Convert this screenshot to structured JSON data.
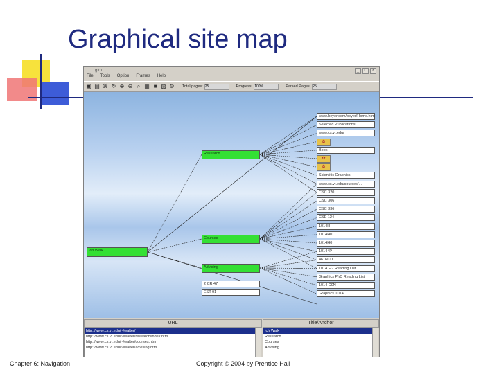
{
  "slide": {
    "title": "Graphical site map",
    "footer_left": "Chapter 6: Navigation",
    "footer_center": "Copyright © 2004 by Prentice Hall"
  },
  "window": {
    "title": "gfm",
    "menu": [
      "File",
      "Tools",
      "Option",
      "Frames",
      "Help"
    ],
    "controls": [
      "_",
      "□",
      "×"
    ],
    "fields": [
      {
        "label": "Total pages:",
        "value": "25"
      },
      {
        "label": "Progress:",
        "value": "100%"
      },
      {
        "label": "Parsed Pages:",
        "value": "25"
      }
    ]
  },
  "nodes": {
    "root": "Ich Walk",
    "green": [
      "Research",
      "Courses",
      "Advising"
    ],
    "advising_children": [
      "2 CR 47",
      "EST 91"
    ],
    "right_column": [
      "www.beyer.com/beyer/Home.htm",
      "Selected Publications",
      "www.cs.vt.edu/",
      "",
      "Book",
      "",
      "",
      "Scientific Graphics",
      "www.cs.vt.edu/courses/...",
      "CSC 320",
      "CSC 306",
      "CSC 336",
      "CSE 124",
      "1014H",
      "1014H0",
      "1014H0",
      "10144P",
      "4616CD",
      "1014 FG Reading List",
      "Graphics PhD Reading List",
      "1014 C0N",
      "Graphics 1014"
    ]
  },
  "bottom": {
    "url_header": "URL",
    "title_header": "Title/Anchor",
    "urls": [
      "http://www.cs.vt.edu/~/walter/",
      "http://www.cs.vt.edu/~/walter/research/index.html",
      "http://www.cs.vt.edu/~/walter/courses.htm",
      "http://www.cs.vt.edu/~/walter/advising.htm"
    ],
    "titles": [
      "Ich Walk",
      "Research",
      "Courses",
      "Advising"
    ]
  }
}
